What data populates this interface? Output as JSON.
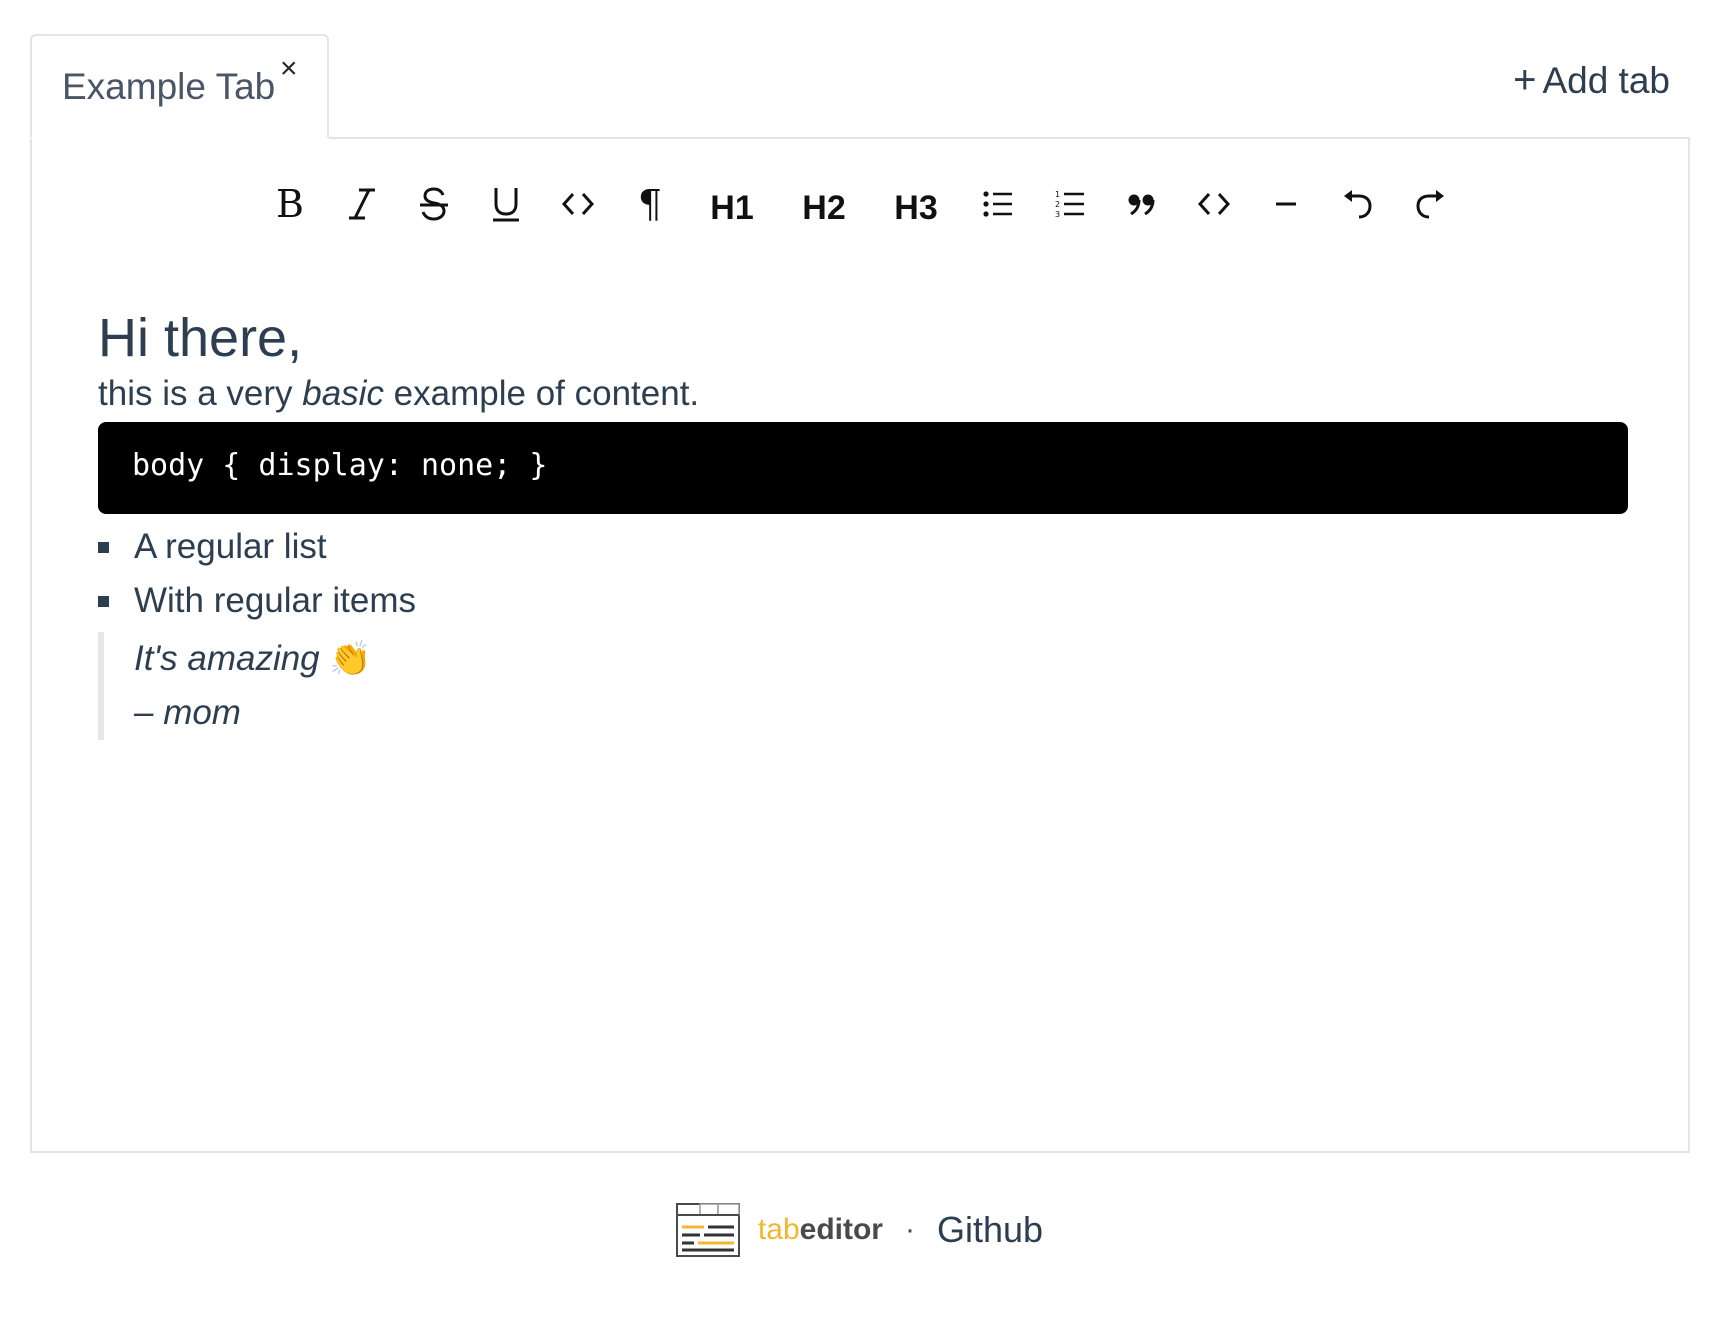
{
  "tabs": {
    "items": [
      {
        "label": "Example Tab",
        "close_glyph": "×",
        "active": true
      }
    ],
    "add_tab_icon": "+",
    "add_tab_label": "Add tab"
  },
  "toolbar": {
    "items": [
      {
        "name": "bold",
        "icon": "bold-icon",
        "glyph": "B"
      },
      {
        "name": "italic",
        "icon": "italic-icon"
      },
      {
        "name": "strike",
        "icon": "strikethrough-icon"
      },
      {
        "name": "underline",
        "icon": "underline-icon"
      },
      {
        "name": "code",
        "icon": "code-icon"
      },
      {
        "name": "paragraph",
        "icon": "paragraph-icon",
        "glyph": "¶"
      },
      {
        "name": "h1",
        "label": "H1"
      },
      {
        "name": "h2",
        "label": "H2"
      },
      {
        "name": "h3",
        "label": "H3"
      },
      {
        "name": "bullet-list",
        "icon": "bullet-list-icon"
      },
      {
        "name": "ordered-list",
        "icon": "ordered-list-icon"
      },
      {
        "name": "blockquote",
        "icon": "quote-icon"
      },
      {
        "name": "code-block",
        "icon": "code-block-icon"
      },
      {
        "name": "horizontal-rule",
        "icon": "horizontal-rule-icon"
      },
      {
        "name": "undo",
        "icon": "undo-icon"
      },
      {
        "name": "redo",
        "icon": "redo-icon"
      }
    ]
  },
  "content": {
    "heading": "Hi there,",
    "paragraph": {
      "before": "this is a very ",
      "emphasis": "basic",
      "after": " example of content."
    },
    "code": "body { display: none; }",
    "list": [
      "A regular list",
      "With regular items"
    ],
    "quote": {
      "line1": "It's amazing ",
      "emoji": "👏",
      "line2": "– mom"
    }
  },
  "footer": {
    "brand_tab": "tab",
    "brand_editor": "editor",
    "separator": "·",
    "link_label": "Github"
  },
  "colors": {
    "text": "#2c3e50",
    "brand_accent": "#f0b72f",
    "code_bg": "#000000",
    "border": "#e1e4e8"
  }
}
